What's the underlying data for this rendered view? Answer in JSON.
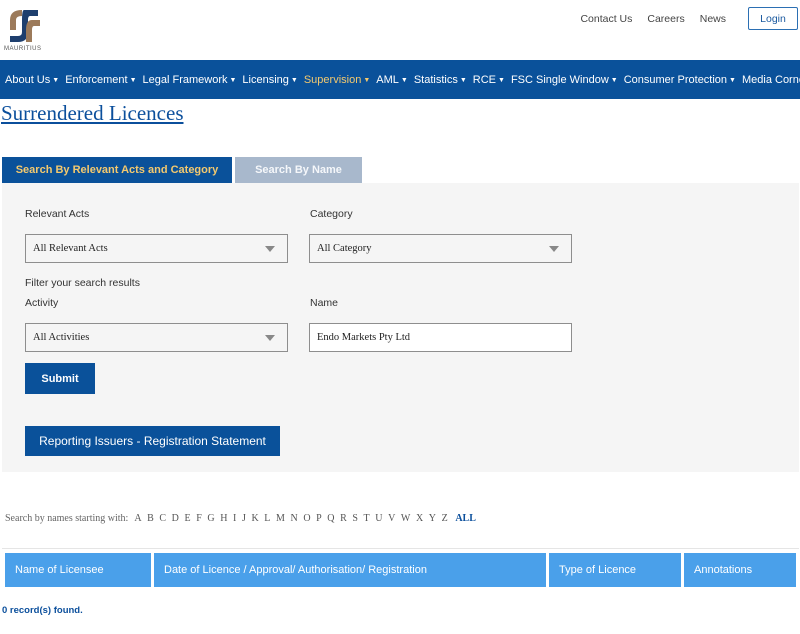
{
  "header": {
    "logo_text": "MAURITIUS",
    "top_links": [
      "Contact Us",
      "Careers",
      "News"
    ],
    "login_label": "Login"
  },
  "nav": {
    "items": [
      {
        "label": "About Us",
        "active": false
      },
      {
        "label": "Enforcement",
        "active": false
      },
      {
        "label": "Legal Framework",
        "active": false
      },
      {
        "label": "Licensing",
        "active": false
      },
      {
        "label": "Supervision",
        "active": true
      },
      {
        "label": "AML",
        "active": false
      },
      {
        "label": "Statistics",
        "active": false
      },
      {
        "label": "RCE",
        "active": false
      },
      {
        "label": "FSC Single Window",
        "active": false
      },
      {
        "label": "Consumer Protection",
        "active": false
      },
      {
        "label": "Media Corner",
        "active": false
      }
    ]
  },
  "page": {
    "title": "Surrendered Licences"
  },
  "tabs": {
    "by_acts": "Search By Relevant Acts and Category",
    "by_name": "Search By Name"
  },
  "form": {
    "relevant_acts_label": "Relevant Acts",
    "relevant_acts_value": "All Relevant Acts",
    "category_label": "Category",
    "category_value": "All Category",
    "filter_label": "Filter your search results",
    "activity_label": "Activity",
    "activity_value": "All Activities",
    "name_label": "Name",
    "name_value": "Endo Markets Pty Ltd",
    "submit_label": "Submit",
    "reporting_label": "Reporting Issuers - Registration Statement"
  },
  "alphabet": {
    "label": "Search by names starting with:",
    "letters": [
      "A",
      "B",
      "C",
      "D",
      "E",
      "F",
      "G",
      "H",
      "I",
      "J",
      "K",
      "L",
      "M",
      "N",
      "O",
      "P",
      "Q",
      "R",
      "S",
      "T",
      "U",
      "V",
      "W",
      "X",
      "Y",
      "Z"
    ],
    "all_label": "ALL"
  },
  "table": {
    "headers": [
      "Name of Licensee",
      "Date of Licence / Approval/ Authorisation/ Registration",
      "Type of Licence",
      "Annotations"
    ]
  },
  "records_text": "0 record(s) found.",
  "colors": {
    "brand_blue": "#0a519a",
    "accent_gold": "#f4c96e",
    "table_header": "#4aa0ea"
  }
}
